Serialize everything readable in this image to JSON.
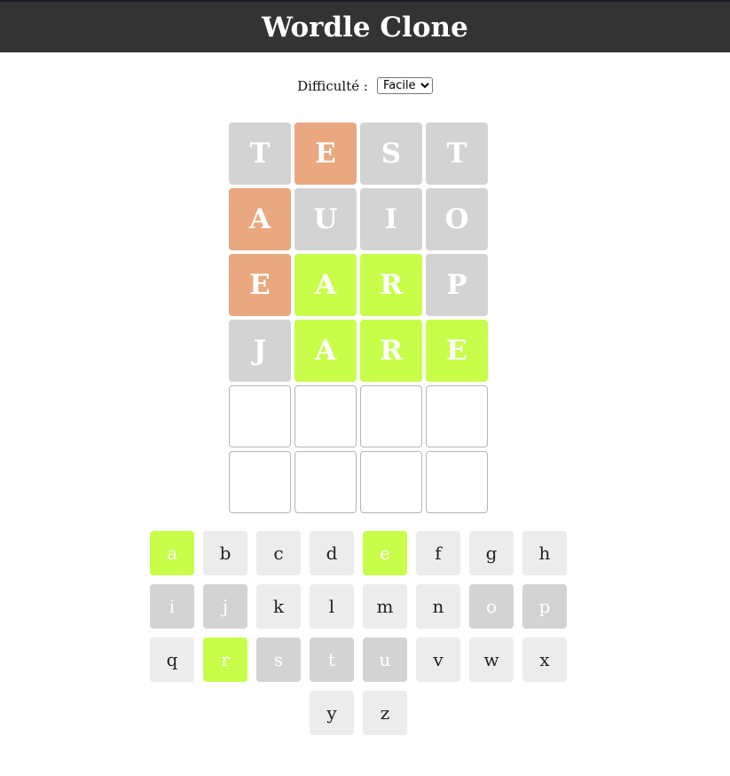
{
  "header": {
    "title": "Wordle Clone"
  },
  "difficulty": {
    "label": "Difficulté :",
    "selected": "Facile",
    "options": [
      "Facile"
    ]
  },
  "colors": {
    "correct": "#c8fd4a",
    "present": "#e9a87f",
    "absent": "#d3d3d3",
    "key_default": "#ececec"
  },
  "board": {
    "rows": [
      [
        {
          "letter": "T",
          "state": "absent"
        },
        {
          "letter": "E",
          "state": "present"
        },
        {
          "letter": "S",
          "state": "absent"
        },
        {
          "letter": "T",
          "state": "absent"
        }
      ],
      [
        {
          "letter": "A",
          "state": "present"
        },
        {
          "letter": "U",
          "state": "absent"
        },
        {
          "letter": "I",
          "state": "absent"
        },
        {
          "letter": "O",
          "state": "absent"
        }
      ],
      [
        {
          "letter": "E",
          "state": "present"
        },
        {
          "letter": "A",
          "state": "correct"
        },
        {
          "letter": "R",
          "state": "correct"
        },
        {
          "letter": "P",
          "state": "absent"
        }
      ],
      [
        {
          "letter": "J",
          "state": "absent"
        },
        {
          "letter": "A",
          "state": "correct"
        },
        {
          "letter": "R",
          "state": "correct"
        },
        {
          "letter": "E",
          "state": "correct"
        }
      ],
      [
        {
          "letter": "",
          "state": "empty"
        },
        {
          "letter": "",
          "state": "empty"
        },
        {
          "letter": "",
          "state": "empty"
        },
        {
          "letter": "",
          "state": "empty"
        }
      ],
      [
        {
          "letter": "",
          "state": "empty"
        },
        {
          "letter": "",
          "state": "empty"
        },
        {
          "letter": "",
          "state": "empty"
        },
        {
          "letter": "",
          "state": "empty"
        }
      ]
    ]
  },
  "keyboard": {
    "rows": [
      [
        {
          "key": "a",
          "state": "correct"
        },
        {
          "key": "b",
          "state": "unused"
        },
        {
          "key": "c",
          "state": "unused"
        },
        {
          "key": "d",
          "state": "unused"
        },
        {
          "key": "e",
          "state": "correct"
        },
        {
          "key": "f",
          "state": "unused"
        },
        {
          "key": "g",
          "state": "unused"
        },
        {
          "key": "h",
          "state": "unused"
        }
      ],
      [
        {
          "key": "i",
          "state": "absent"
        },
        {
          "key": "j",
          "state": "absent"
        },
        {
          "key": "k",
          "state": "unused"
        },
        {
          "key": "l",
          "state": "unused"
        },
        {
          "key": "m",
          "state": "unused"
        },
        {
          "key": "n",
          "state": "unused"
        },
        {
          "key": "o",
          "state": "absent"
        },
        {
          "key": "p",
          "state": "absent"
        }
      ],
      [
        {
          "key": "q",
          "state": "unused"
        },
        {
          "key": "r",
          "state": "correct"
        },
        {
          "key": "s",
          "state": "absent"
        },
        {
          "key": "t",
          "state": "absent"
        },
        {
          "key": "u",
          "state": "absent"
        },
        {
          "key": "v",
          "state": "unused"
        },
        {
          "key": "w",
          "state": "unused"
        },
        {
          "key": "x",
          "state": "unused"
        }
      ],
      [
        {
          "key": "y",
          "state": "unused"
        },
        {
          "key": "z",
          "state": "unused"
        }
      ]
    ]
  }
}
